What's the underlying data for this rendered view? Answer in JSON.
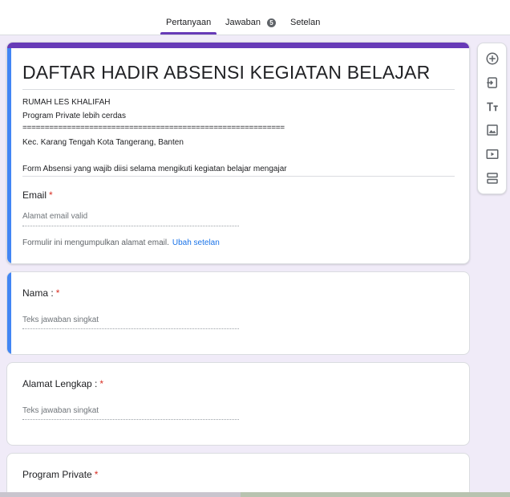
{
  "tabs": [
    {
      "label": "Pertanyaan",
      "active": true
    },
    {
      "label": "Jawaban",
      "badge": "5"
    },
    {
      "label": "Setelan"
    }
  ],
  "form": {
    "title": "DAFTAR HADIR ABSENSI KEGIATAN BELAJAR",
    "description_lines": [
      "RUMAH LES KHALIFAH",
      "Program Private lebih cerdas",
      "===========================================================",
      "Kec. Karang Tengah Kota Tangerang, Banten",
      "",
      "Form Absensi yang wajib diisi selama mengikuti kegiatan belajar mengajar"
    ],
    "email": {
      "label": "Email",
      "required_mark": "*",
      "placeholder": "Alamat email valid",
      "note": "Formulir ini mengumpulkan alamat email.",
      "note_link": "Ubah setelan"
    }
  },
  "questions": [
    {
      "label": "Nama :",
      "required_mark": "*",
      "placeholder": "Teks jawaban singkat"
    },
    {
      "label": "Alamat Lengkap :",
      "required_mark": "*",
      "placeholder": "Teks jawaban singkat"
    },
    {
      "label": "Program Private",
      "required_mark": "*"
    }
  ],
  "toolbar": {
    "icons": [
      "add-question-icon",
      "import-questions-icon",
      "add-title-icon",
      "add-image-icon",
      "add-video-icon",
      "add-section-icon"
    ]
  },
  "colors": {
    "accent": "#673ab7",
    "focus": "#4285f4",
    "background": "#f0ebf8",
    "required": "#d93025",
    "link": "#1a73e8"
  }
}
